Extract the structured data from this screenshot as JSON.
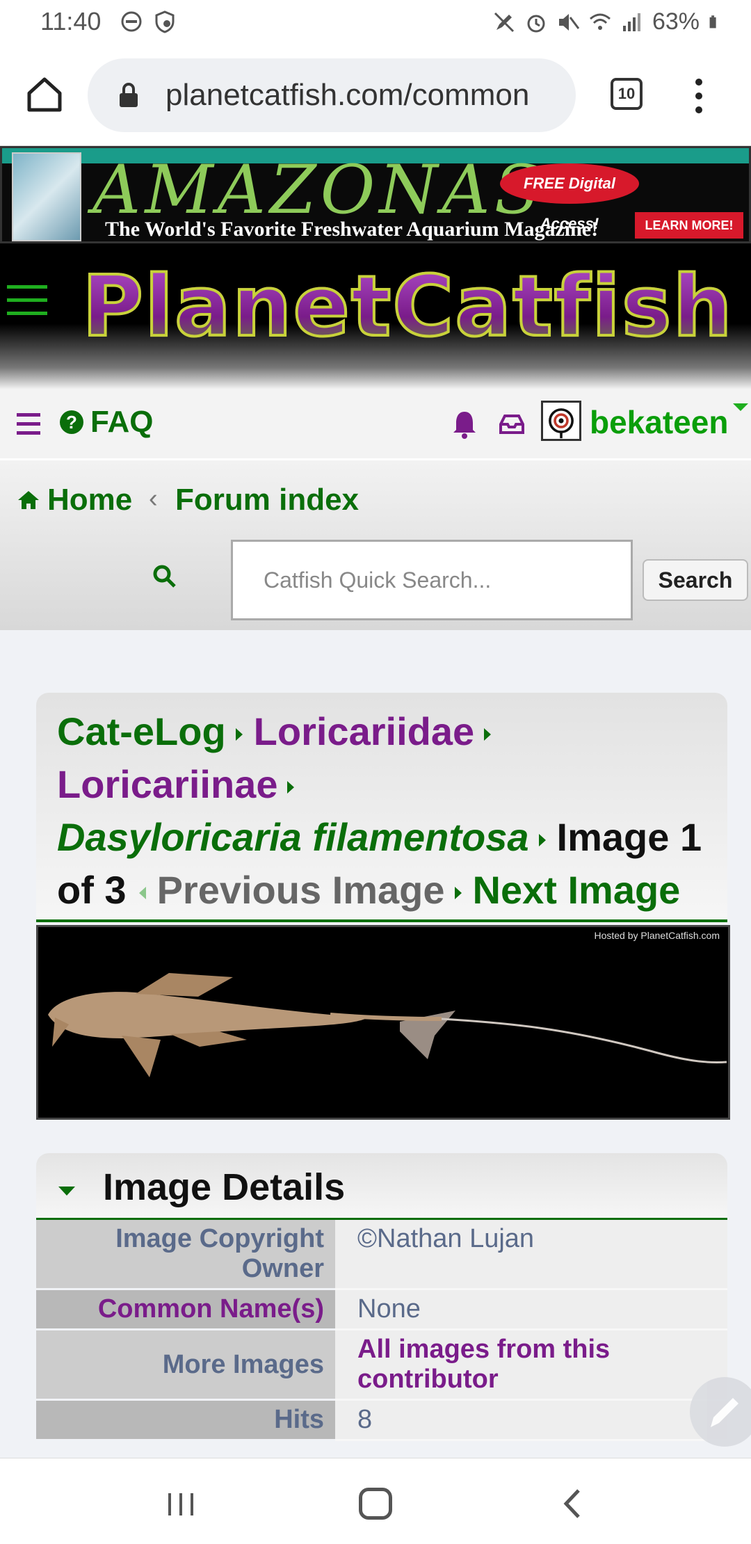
{
  "status_bar": {
    "time": "11:40",
    "battery": "63%"
  },
  "browser": {
    "url": "planetcatfish.com/common",
    "tab_count": "10"
  },
  "ad": {
    "title": "AMAZONAS",
    "tagline": "The World's Favorite Freshwater Aquarium Magazine!",
    "badge": "FREE Digital Access!",
    "cta": "LEARN MORE!"
  },
  "site": {
    "logo": "PlanetCatfish"
  },
  "nav": {
    "faq": "FAQ",
    "username": "bekateen"
  },
  "breadcrumb": {
    "home": "Home",
    "forum": "Forum index"
  },
  "search": {
    "placeholder": "Catfish Quick Search...",
    "button": "Search"
  },
  "catelog": {
    "root": "Cat-eLog",
    "family": "Loricariidae",
    "subfamily": "Loricariinae",
    "species": "Dasyloricaria filamentosa",
    "image_pos": "Image 1",
    "image_of": "of 3",
    "prev": "Previous Image",
    "next": "Next Image"
  },
  "photo": {
    "credit": "Hosted by PlanetCatfish.com"
  },
  "details": {
    "title": "Image Details",
    "rows": [
      {
        "key": "Image Copyright Owner",
        "value": "©Nathan Lujan"
      },
      {
        "key": "Common Name(s)",
        "value": "None"
      },
      {
        "key": "More Images",
        "value": "All images from this contributor"
      },
      {
        "key": "Hits",
        "value": "8"
      }
    ]
  },
  "colors": {
    "brand_green": "#0a6e0a",
    "brand_purple": "#7a1c8a"
  }
}
